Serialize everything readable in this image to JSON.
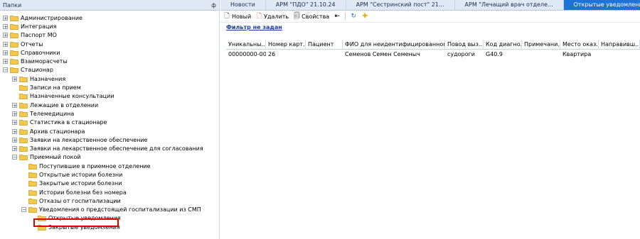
{
  "left_panel": {
    "title": "Папки",
    "pin": "ф",
    "tree": [
      {
        "label": "Администрирование",
        "indent": 0,
        "exp": "+"
      },
      {
        "label": "Интеграция",
        "indent": 0,
        "exp": "+"
      },
      {
        "label": "Паспорт МО",
        "indent": 0,
        "exp": "+"
      },
      {
        "label": "Отчеты",
        "indent": 0,
        "exp": "+"
      },
      {
        "label": "Справочники",
        "indent": 0,
        "exp": "+"
      },
      {
        "label": "Взаиморасчеты",
        "indent": 0,
        "exp": "+"
      },
      {
        "label": "Стационар",
        "indent": 0,
        "exp": "−"
      },
      {
        "label": "Назначения",
        "indent": 1,
        "exp": "+"
      },
      {
        "label": "Записи на прием",
        "indent": 1,
        "exp": ""
      },
      {
        "label": "Назначенные консультации",
        "indent": 1,
        "exp": ""
      },
      {
        "label": "Лежащие в отделении",
        "indent": 1,
        "exp": "+"
      },
      {
        "label": "Телемедицина",
        "indent": 1,
        "exp": "+"
      },
      {
        "label": "Статистика в стационаре",
        "indent": 1,
        "exp": "+"
      },
      {
        "label": "Архив стационара",
        "indent": 1,
        "exp": "+"
      },
      {
        "label": "Заявки на лекарственное обеспечение",
        "indent": 1,
        "exp": "+"
      },
      {
        "label": "Заявки на лекарственное обеспечение для согласования",
        "indent": 1,
        "exp": "+"
      },
      {
        "label": "Приемный покой",
        "indent": 1,
        "exp": "−"
      },
      {
        "label": "Поступившие в приемное отделение",
        "indent": 2,
        "exp": ""
      },
      {
        "label": "Открытые истории болезни",
        "indent": 2,
        "exp": ""
      },
      {
        "label": "Закрытые истории болезни",
        "indent": 2,
        "exp": ""
      },
      {
        "label": "Истории болезни без номера",
        "indent": 2,
        "exp": ""
      },
      {
        "label": "Отказы от госпитализации",
        "indent": 2,
        "exp": ""
      },
      {
        "label": "Уведомления о предстоящей госпитализации из СМП",
        "indent": 2,
        "exp": "−"
      },
      {
        "label": "Открытые уведомления",
        "indent": 3,
        "exp": "",
        "selected": true
      },
      {
        "label": "Закрытые уведомления",
        "indent": 3,
        "exp": ""
      }
    ]
  },
  "tabs": [
    {
      "label": "Новости",
      "active": false
    },
    {
      "label": "АРМ \"ПДО\" 21.10.24",
      "active": false
    },
    {
      "label": "АРМ \"Сестринский пост\" 21...",
      "active": false
    },
    {
      "label": "АРМ \"Лечащий врач отделе...",
      "active": false
    },
    {
      "label": "Открытые уведомления",
      "active": true
    }
  ],
  "toolbar": {
    "new_label": "Новый",
    "delete_label": "Удалить",
    "props_label": "Свойства"
  },
  "filter_text": "Фильтр не задан",
  "table": {
    "columns": [
      {
        "label": "Уникальны...",
        "w": 56
      },
      {
        "label": "Номер карт...",
        "w": 56
      },
      {
        "label": "Пациент",
        "w": 52
      },
      {
        "label": "ФИО для неидентифицированного п...",
        "w": 144
      },
      {
        "label": "Повод выз...",
        "w": 54
      },
      {
        "label": "Код диагно...",
        "w": 54
      },
      {
        "label": "Примечани...",
        "w": 54
      },
      {
        "label": "Место оказ...",
        "w": 54
      },
      {
        "label": "Направивш...",
        "w": 58
      }
    ],
    "rows": [
      [
        "00000000-00...",
        "26",
        "",
        "Семенов Семен Семеныч",
        "судороги",
        "G40.9",
        "",
        "Квартира",
        ""
      ]
    ]
  },
  "colors": {
    "accent": "#1e73d8",
    "highlight_border": "#e00000",
    "folder": "#f5c84c"
  }
}
